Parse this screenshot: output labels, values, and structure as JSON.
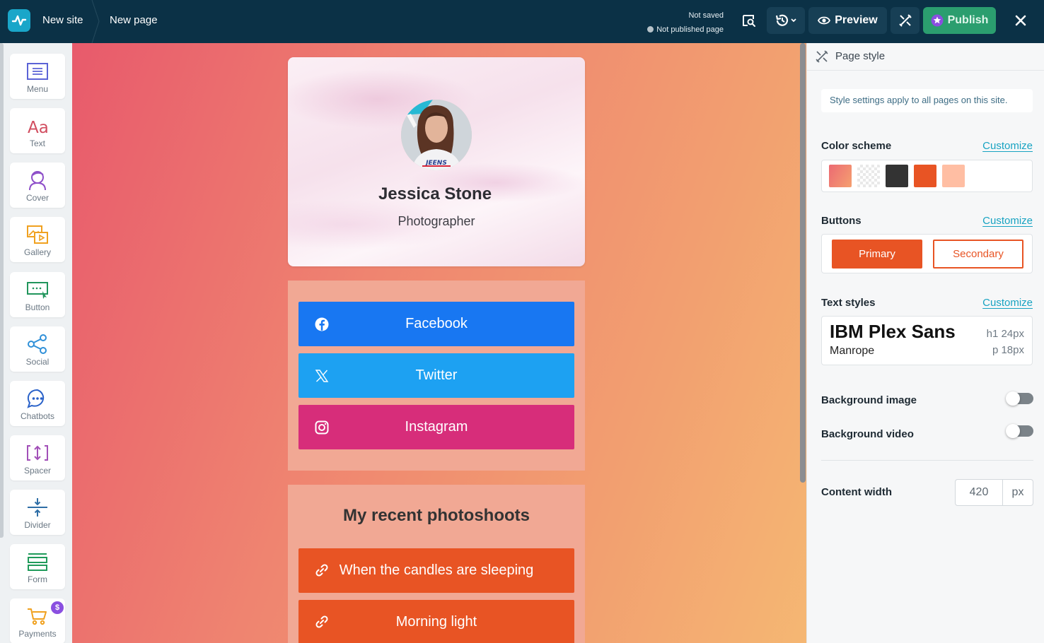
{
  "topbar": {
    "site_name": "New site",
    "page_name": "New page",
    "save_status": "Not saved",
    "publish_status": "Not published page",
    "preview_label": "Preview",
    "publish_label": "Publish"
  },
  "toolbar": {
    "items": [
      {
        "label": "Menu",
        "icon": "menu-icon"
      },
      {
        "label": "Text",
        "icon": "text-icon"
      },
      {
        "label": "Cover",
        "icon": "cover-icon"
      },
      {
        "label": "Gallery",
        "icon": "gallery-icon"
      },
      {
        "label": "Button",
        "icon": "button-icon"
      },
      {
        "label": "Social",
        "icon": "social-icon"
      },
      {
        "label": "Chatbots",
        "icon": "chatbots-icon"
      },
      {
        "label": "Spacer",
        "icon": "spacer-icon"
      },
      {
        "label": "Divider",
        "icon": "divider-icon"
      },
      {
        "label": "Form",
        "icon": "form-icon"
      },
      {
        "label": "Payments",
        "icon": "payments-icon",
        "badge": "$"
      }
    ]
  },
  "canvas": {
    "profile": {
      "name": "Jessica Stone",
      "role": "Photographer"
    },
    "social_buttons": [
      {
        "label": "Facebook",
        "color": "#1877f2"
      },
      {
        "label": "Twitter",
        "color": "#1da1f2"
      },
      {
        "label": "Instagram",
        "color": "#d72d7a"
      }
    ],
    "shoots": {
      "title": "My recent photoshoots",
      "links": [
        "When the candles are sleeping",
        "Morning light"
      ]
    }
  },
  "panel": {
    "title": "Page style",
    "note": "Style settings apply to all pages on this site.",
    "color_scheme": {
      "label": "Color scheme",
      "customize": "Customize",
      "swatches": [
        "#ec6a73",
        "checkered",
        "#333333",
        "#e85424",
        "#ffbea3"
      ]
    },
    "buttons": {
      "label": "Buttons",
      "customize": "Customize",
      "primary": "Primary",
      "secondary": "Secondary"
    },
    "text_styles": {
      "label": "Text styles",
      "customize": "Customize",
      "heading_font": "IBM Plex Sans",
      "body_font": "Manrope",
      "h1": "h1  24px",
      "p": "p  18px"
    },
    "background_image": {
      "label": "Background image",
      "enabled": false
    },
    "background_video": {
      "label": "Background video",
      "enabled": false
    },
    "content_width": {
      "label": "Content width",
      "value": "420",
      "unit": "px"
    }
  }
}
